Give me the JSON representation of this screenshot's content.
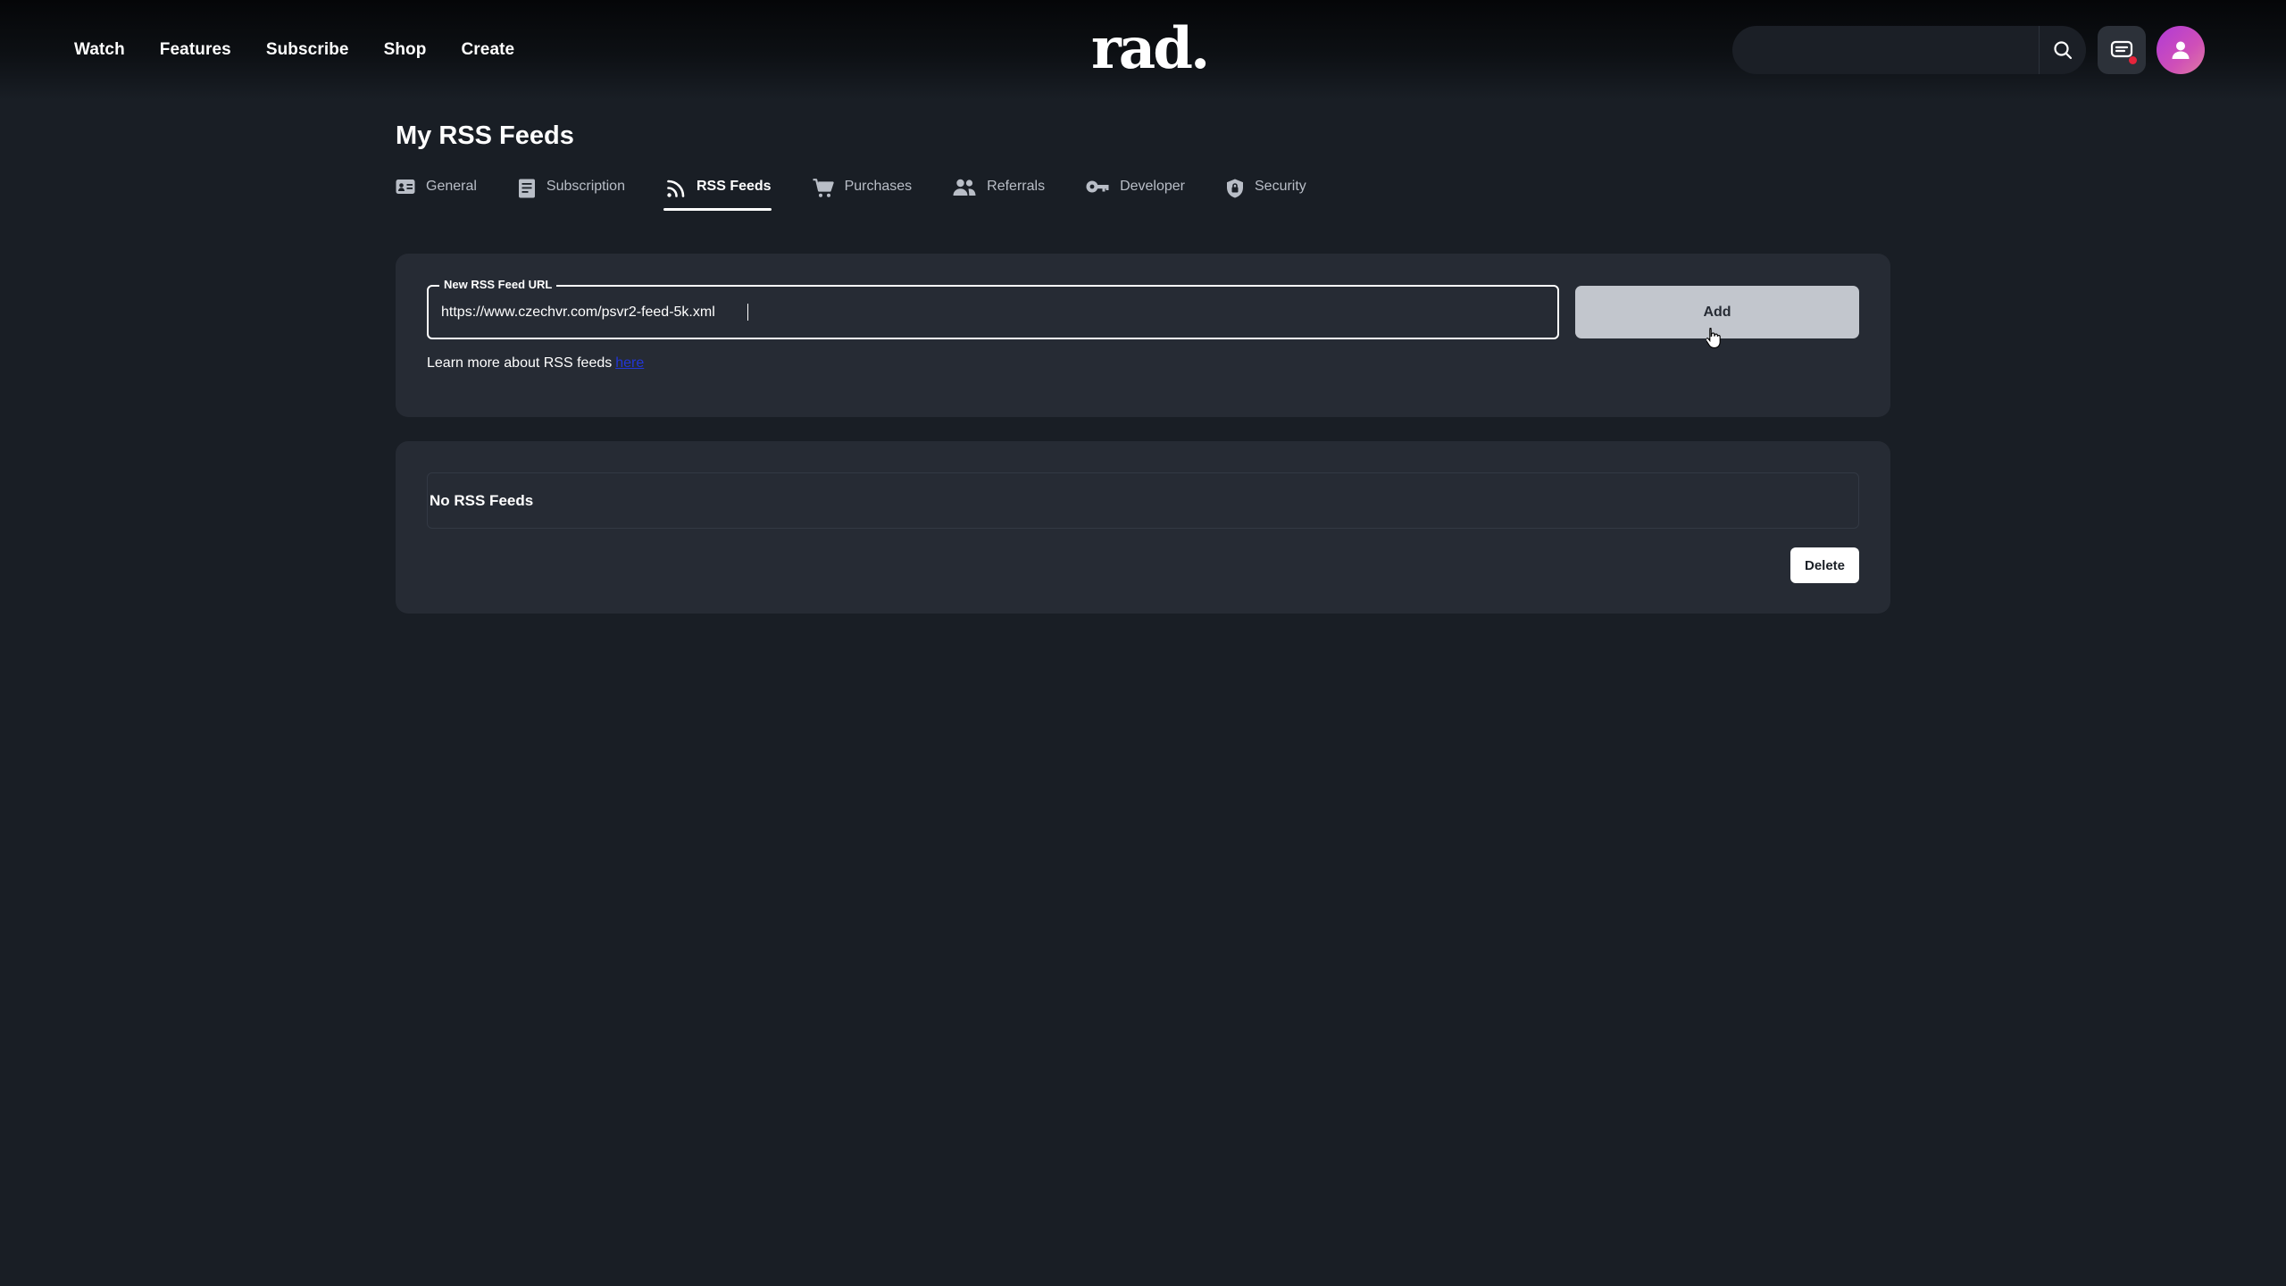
{
  "nav": {
    "links": [
      "Watch",
      "Features",
      "Subscribe",
      "Shop",
      "Create"
    ],
    "logo": "rad.",
    "search": {
      "value": "",
      "icon": "search-icon"
    },
    "chat_icon": "chat-icon",
    "notification_color": "#e5243b",
    "avatar_icon": "user-icon"
  },
  "page": {
    "title": "My RSS Feeds",
    "tabs": [
      {
        "label": "General",
        "icon": "id-card-icon",
        "active": false
      },
      {
        "label": "Subscription",
        "icon": "receipt-icon",
        "active": false
      },
      {
        "label": "RSS Feeds",
        "icon": "rss-icon",
        "active": true
      },
      {
        "label": "Purchases",
        "icon": "cart-icon",
        "active": false
      },
      {
        "label": "Referrals",
        "icon": "users-icon",
        "active": false
      },
      {
        "label": "Developer",
        "icon": "key-icon",
        "active": false
      },
      {
        "label": "Security",
        "icon": "shield-icon",
        "active": false
      }
    ]
  },
  "add_form": {
    "field_label": "New RSS Feed URL",
    "field_value": "https://www.czechvr.com/psvr2-feed-5k.xml",
    "add_label": "Add",
    "learn_more_text": "Learn more about RSS feeds",
    "learn_more_link": "here"
  },
  "feeds": {
    "empty_text": "No RSS Feeds",
    "delete_label": "Delete"
  },
  "colors": {
    "background": "#191e25",
    "card": "#262b34",
    "accent_avatar": "#b03ad6",
    "link": "#2236d6"
  }
}
